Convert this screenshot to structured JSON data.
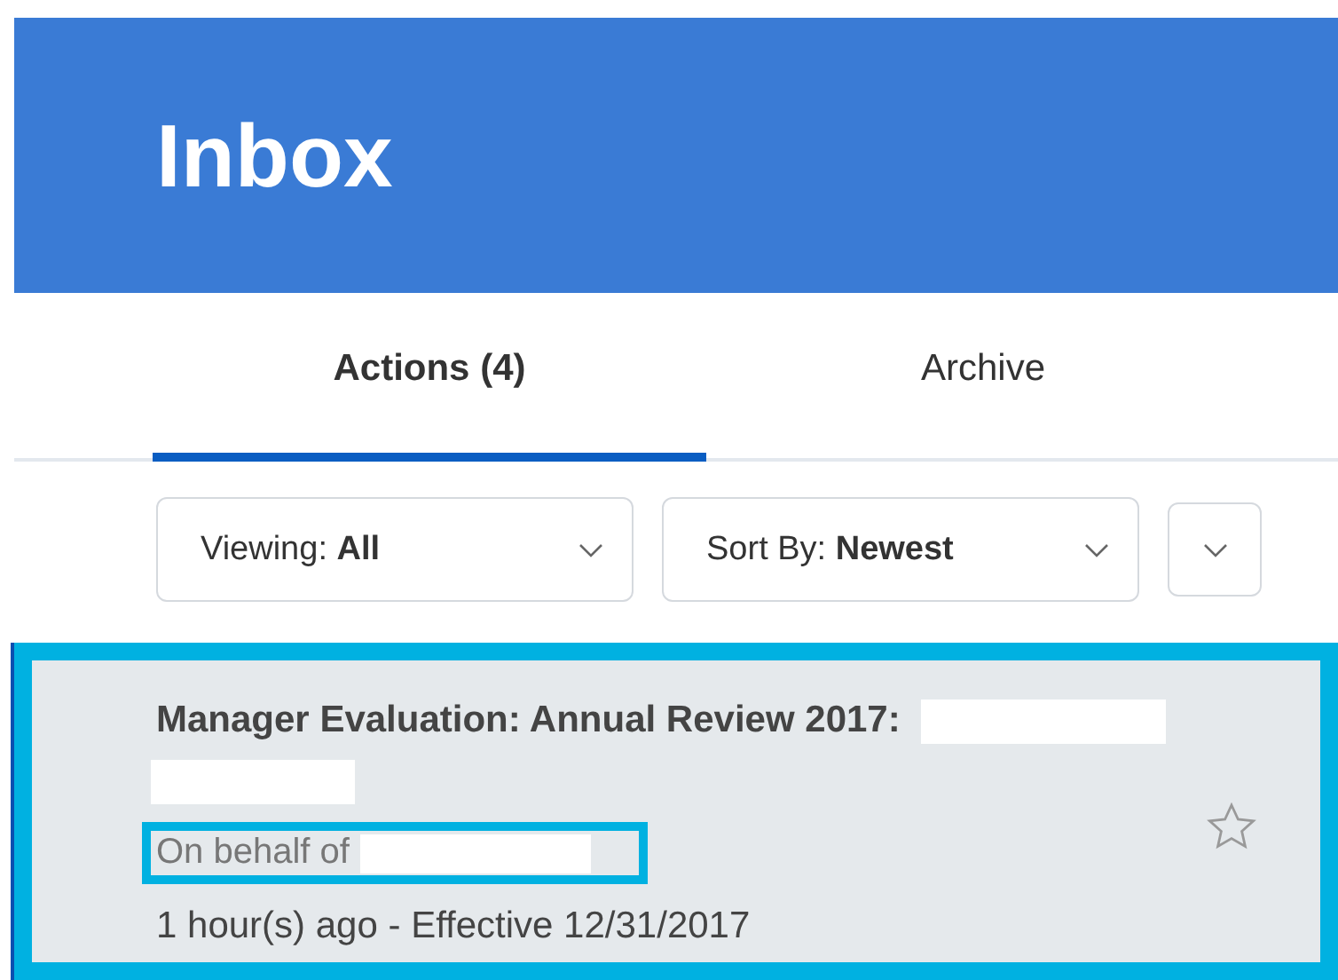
{
  "header": {
    "title": "Inbox"
  },
  "tabs": [
    {
      "label": "Actions (4)",
      "selected": true
    },
    {
      "label": "Archive",
      "selected": false
    }
  ],
  "filters": [
    {
      "label": "Viewing:",
      "value": "All"
    },
    {
      "label": "Sort By:",
      "value": "Newest"
    }
  ],
  "items": [
    {
      "title": "Manager Evaluation: Annual Review 2017:",
      "on_behalf": "On behalf of",
      "time": "1 hour(s) ago - Effective 12/31/2017",
      "starred": false,
      "highlighted": true
    }
  ]
}
